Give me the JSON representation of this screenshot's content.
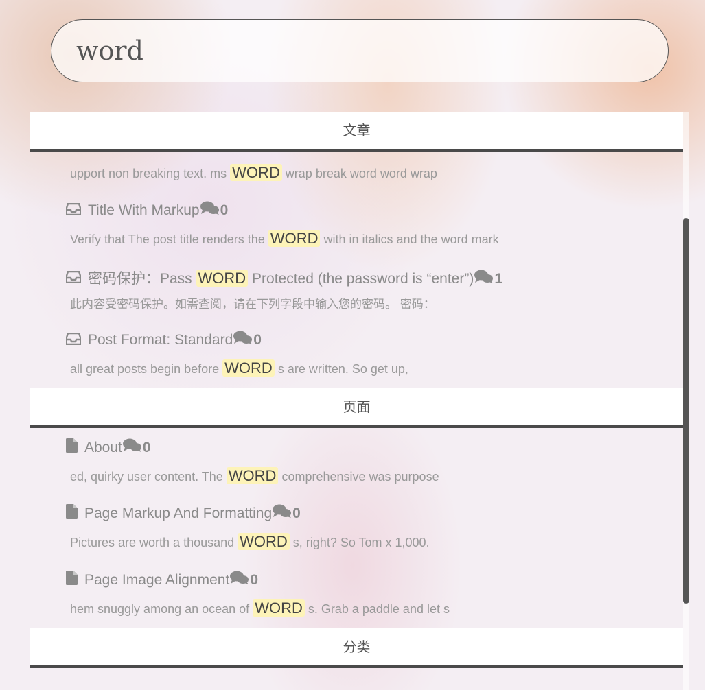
{
  "search": {
    "value": "word"
  },
  "sections": {
    "posts": {
      "header": "文章",
      "lead_snippet": {
        "before": "upport non breaking text. ms ",
        "hl": "WORD",
        "after": " wrap break word word wrap"
      },
      "items": [
        {
          "title": "Title With Markup",
          "count": "0",
          "snippet_before": "Verify that The post title renders the ",
          "snippet_hl": "WORD",
          "snippet_after": " with in italics and the word mark"
        },
        {
          "title_before": "密码保护：Pass ",
          "title_hl": "WORD",
          "title_after": " Protected (the password is “enter”)",
          "count": "1",
          "snippet": "此内容受密码保护。如需查阅，请在下列字段中输入您的密码。 密码："
        },
        {
          "title": "Post Format: Standard",
          "count": "0",
          "snippet_before": "all great posts begin before ",
          "snippet_hl": "WORD",
          "snippet_after": " s are written. So get up,"
        }
      ]
    },
    "pages": {
      "header": "页面",
      "items": [
        {
          "title": "About",
          "count": "0",
          "snippet_before": "ed, quirky user content. The ",
          "snippet_hl": "WORD",
          "snippet_after": " comprehensive was purpose"
        },
        {
          "title": "Page Markup And Formatting",
          "count": "0",
          "snippet_before": "Pictures are worth a thousand ",
          "snippet_hl": "WORD",
          "snippet_after": " s, right? So Tom x 1,000."
        },
        {
          "title": "Page Image Alignment",
          "count": "0",
          "snippet_before": "hem snuggly among an ocean of ",
          "snippet_hl": "WORD",
          "snippet_after": " s. Grab a paddle and let s"
        }
      ]
    },
    "categories": {
      "header": "分类"
    }
  },
  "icons": {
    "post": "inbox-icon",
    "page": "file-icon",
    "comments": "comments-icon"
  }
}
